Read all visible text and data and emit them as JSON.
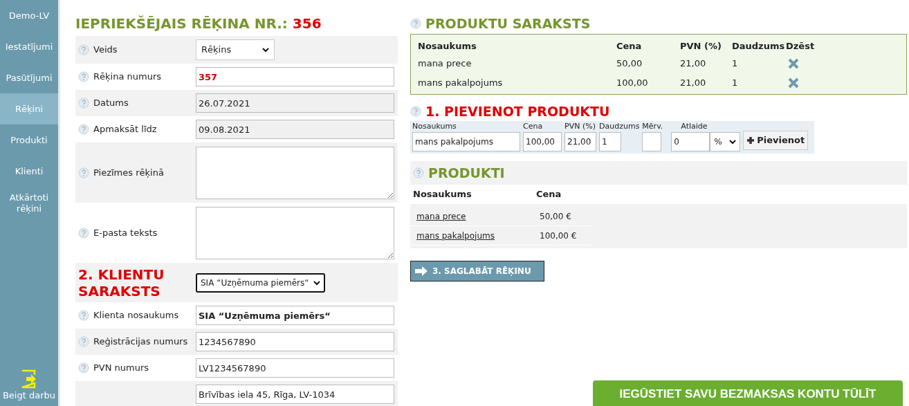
{
  "sidebar": {
    "items": [
      {
        "label": "Demo-LV",
        "selected": false
      },
      {
        "label": "Iestatījumi",
        "selected": false
      },
      {
        "label": "Pasūtījumi",
        "selected": false
      },
      {
        "label": "Rēķini",
        "selected": true
      },
      {
        "label": "Produkti",
        "selected": false
      },
      {
        "label": "Klienti",
        "selected": false
      },
      {
        "label": "Atkārtoti rēķini",
        "selected": false
      }
    ],
    "logout": {
      "label": "Beigt darbu"
    }
  },
  "invoice_form": {
    "title": "IEPRIEKŠĒJAIS RĒĶINA NR.:",
    "previous_number": "356",
    "rows": [
      {
        "kind": "select",
        "label": "Veids",
        "value": "Rēķins",
        "help": true
      },
      {
        "kind": "input",
        "label": "Rēķina numurs",
        "value": "357",
        "help": true,
        "readonly": false,
        "red": true
      },
      {
        "kind": "input",
        "label": "Datums",
        "value": "26.07.2021",
        "help": true,
        "readonly": true
      },
      {
        "kind": "input",
        "label": "Apmaksāt līdz",
        "value": "09.08.2021",
        "help": true,
        "readonly": true
      },
      {
        "kind": "textarea",
        "label": "Piezīmes rēķinā",
        "help": true
      },
      {
        "kind": "textarea",
        "label": "E-pasta teksts",
        "help": true
      },
      {
        "kind": "heading",
        "label": "2. KLIENTU SARAKSTS",
        "value": "SIA “Uzņēmuma piemērs“"
      },
      {
        "kind": "input",
        "label": "Klienta nosaukums",
        "value": "SIA “Uzņēmuma piemērs“",
        "help": true,
        "readonly": false,
        "bold": true
      },
      {
        "kind": "input",
        "label": "Reģistrācijas numurs",
        "value": "1234567890",
        "help": true,
        "readonly": false
      },
      {
        "kind": "input",
        "label": "PVN numurs",
        "value": "LV1234567890",
        "help": true,
        "readonly": false
      },
      {
        "kind": "input",
        "value": "Brīvības iela 45, Rīga, LV-1034",
        "help": false,
        "readonly": false
      }
    ]
  },
  "product_list": {
    "title": "PRODUKTU SARAKSTS",
    "columns": [
      "Nosaukums",
      "Cena",
      "PVN (%)",
      "Daudzums",
      "Dzēst"
    ],
    "rows": [
      [
        "mana prece",
        "50,00",
        "21,00",
        "1"
      ],
      [
        "mans pakalpojums",
        "100,00",
        "21,00",
        "1"
      ]
    ]
  },
  "add_product": {
    "title": "1. PIEVIENOT PRODUKTU",
    "fields": [
      {
        "label": "Nosaukums",
        "value": "mans pakalpojums"
      },
      {
        "label": "Cena",
        "value": "100,00"
      },
      {
        "label": "PVN (%)",
        "value": "21,00"
      },
      {
        "label": "Daudzums",
        "value": "1"
      },
      {
        "label": "Mērv."
      },
      {
        "label": "Atlaide",
        "value": "0"
      }
    ],
    "discount_unit": "%",
    "button": "Pievienot"
  },
  "products": {
    "title": "PRODUKTI",
    "columns": [
      "Nosaukums",
      "Cena"
    ],
    "rows": [
      [
        "mana prece",
        "50,00 €"
      ],
      [
        "mans pakalpojums",
        "100,00 €"
      ]
    ]
  },
  "save_button": "3. SAGLABĀT RĒĶINU",
  "cta_button": "IEGŪSTIET SAVU BEZMAKSAS KONTU TŪLĪT"
}
